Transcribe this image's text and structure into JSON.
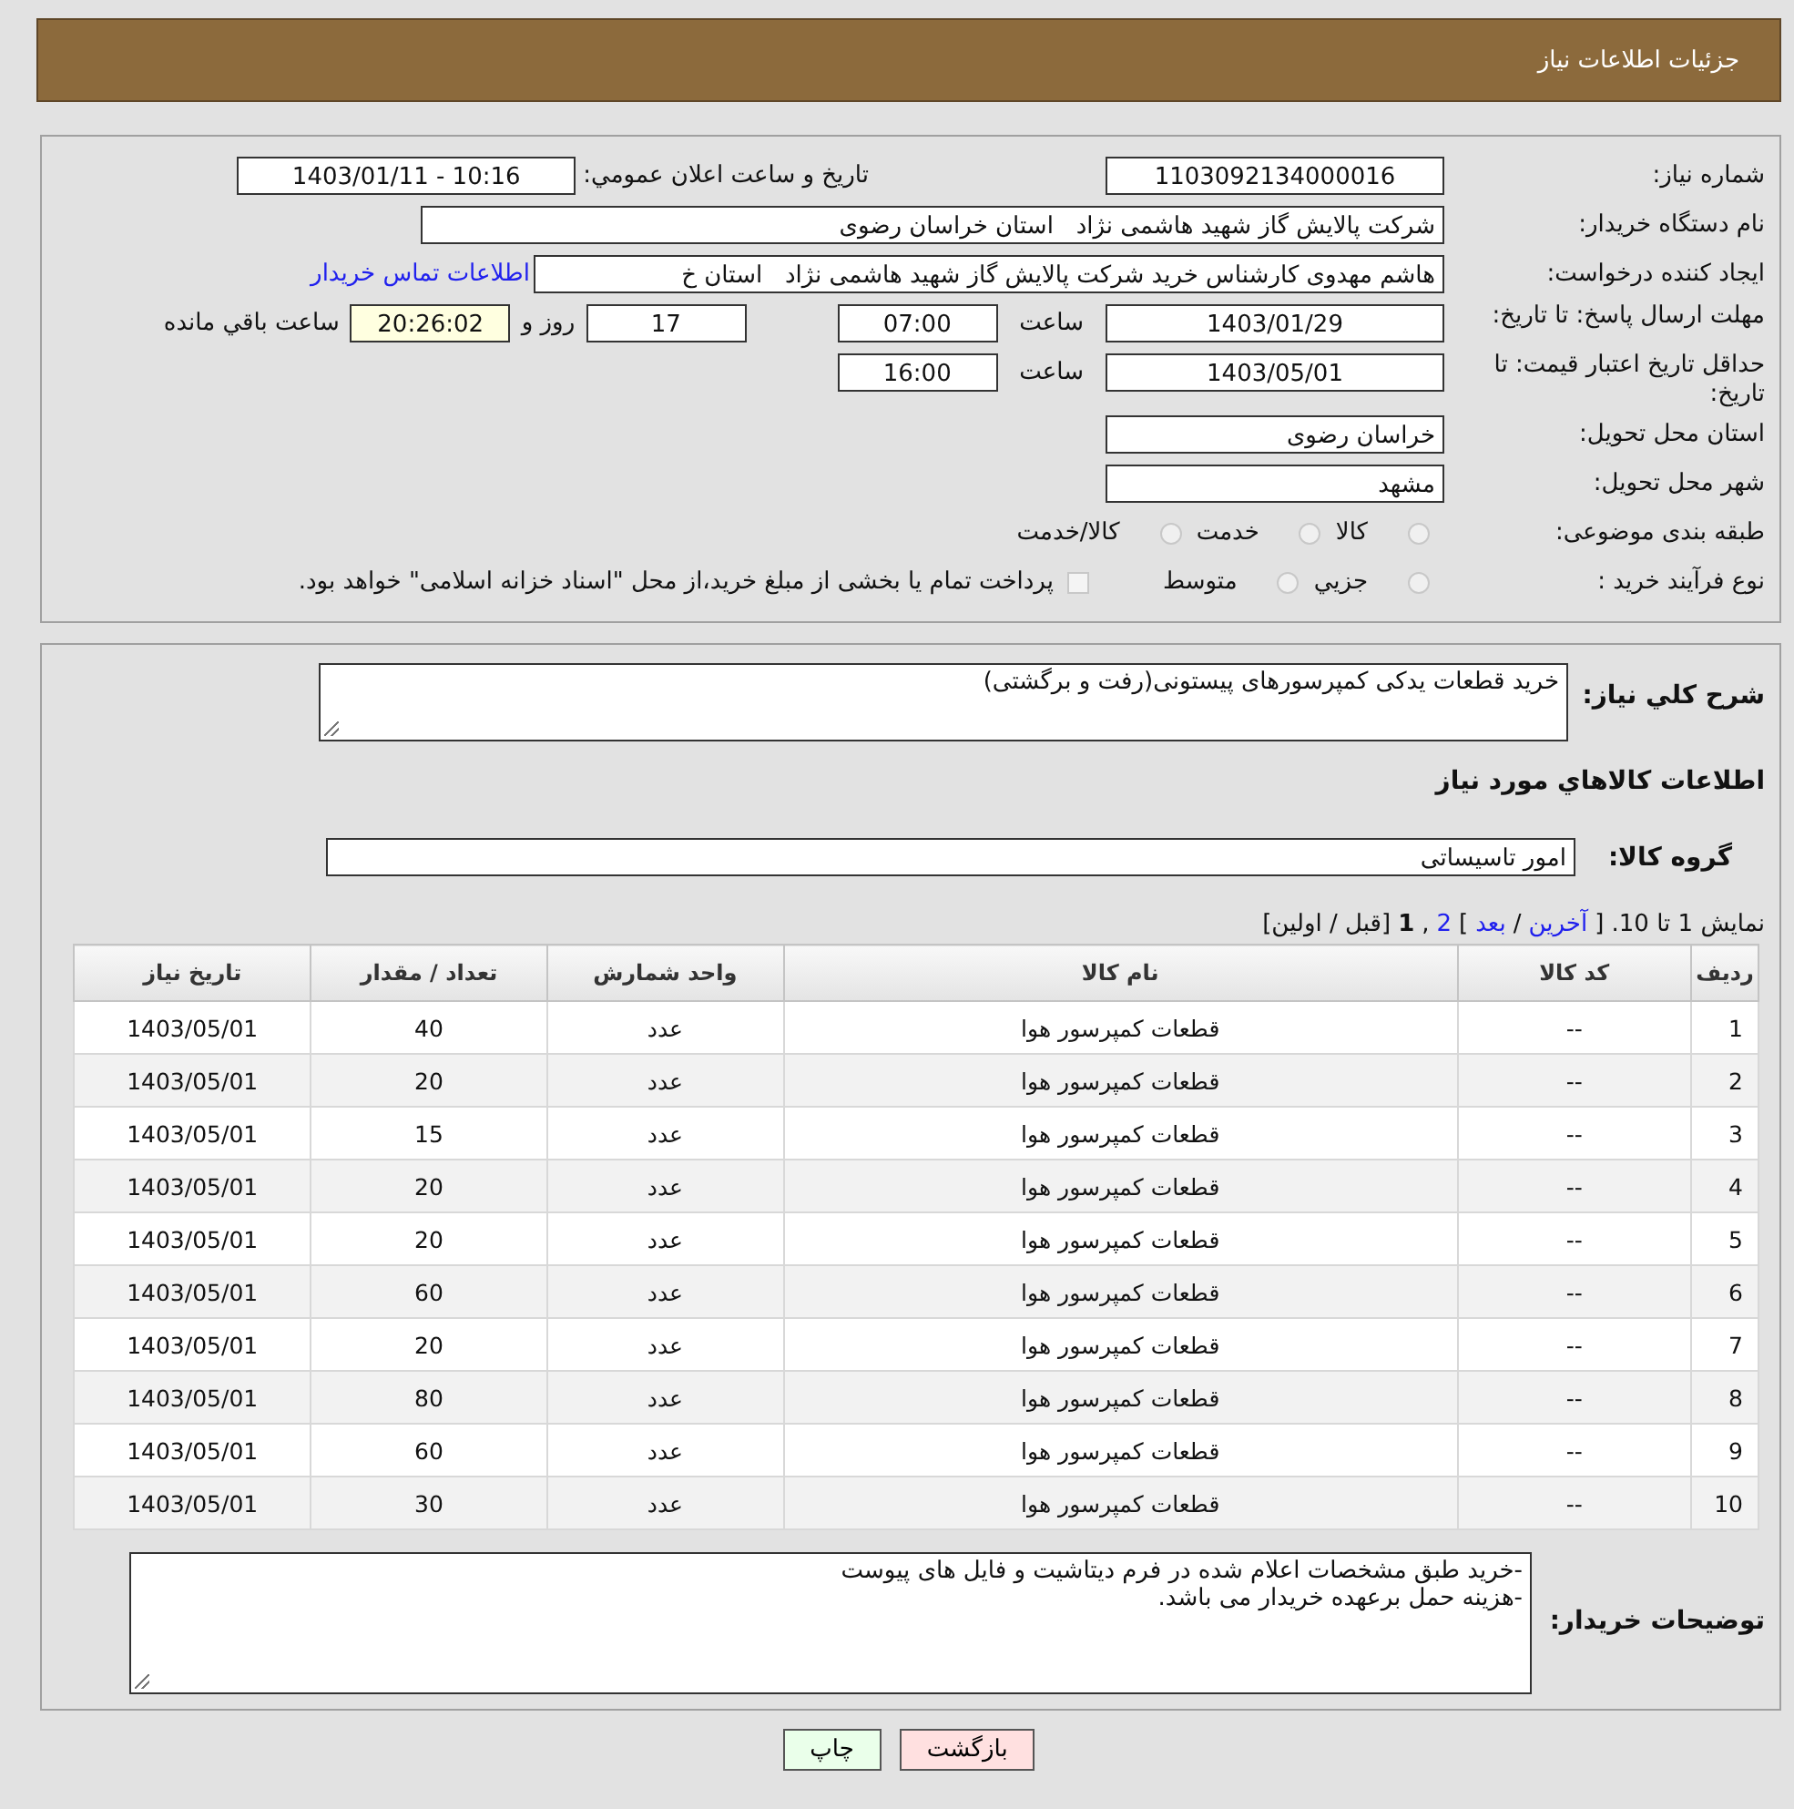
{
  "header": {
    "title": "جزئیات اطلاعات نیاز"
  },
  "details": {
    "need_number": {
      "label": "شماره نیاز:",
      "value": "1103092134000016"
    },
    "announce": {
      "label": "تاریخ و ساعت اعلان عمومي:",
      "value": "1403/01/11 - 10:16"
    },
    "buyer": {
      "label": "نام دستگاه خريدار:",
      "value": "شرکت پالایش گاز شهید هاشمی نژاد   استان خراسان رضوی"
    },
    "requester": {
      "label": "ايجاد کننده درخواست:",
      "value": "هاشم مهدوی کارشناس خرید شرکت پالایش گاز شهید هاشمی نژاد   استان خ",
      "link": "اطلاعات تماس خريدار"
    },
    "deadline": {
      "label": "مهلت ارسال پاسخ: تا تاریخ:",
      "date": "1403/01/29",
      "time_label": "ساعت",
      "time": "07:00",
      "days": "17",
      "days_label": "روز و",
      "remaining": "20:26:02",
      "remaining_label": "ساعت باقي مانده"
    },
    "validity": {
      "label": "حداقل تاريخ اعتبار قيمت: تا تاریخ:",
      "date": "1403/05/01",
      "time_label": "ساعت",
      "time": "16:00"
    },
    "province": {
      "label": "استان محل تحويل:",
      "value": "خراسان رضوی"
    },
    "city": {
      "label": "شهر محل تحويل:",
      "value": "مشهد"
    },
    "category": {
      "label": "طبقه بندی موضوعی:",
      "options": [
        {
          "label": "کالا",
          "selected": false
        },
        {
          "label": "خدمت",
          "selected": false
        },
        {
          "label": "کالا/خدمت",
          "selected": false
        }
      ]
    },
    "process": {
      "label": "نوع فرآیند خرید :",
      "options": [
        {
          "label": "جزيي",
          "selected": false
        },
        {
          "label": "متوسط",
          "selected": false
        }
      ],
      "payment": {
        "checked": false,
        "label": "پرداخت تمام یا بخشی از مبلغ خرید،از محل \"اسناد خزانه اسلامی\" خواهد بود."
      }
    }
  },
  "need": {
    "description": {
      "label": "شرح کلي نياز:",
      "value": "خرید قطعات یدکی کمپرسورهای پیستونی(رفت و برگشتی)"
    },
    "goods_title": "اطلاعات کالاهاي مورد نياز",
    "group": {
      "label": "گروه کالا:",
      "value": "امور تاسیساتی"
    },
    "pagination": [
      {
        "kind": "text",
        "text": "نمایش 1 تا 10. ["
      },
      {
        "kind": "link",
        "text": "آخرین"
      },
      {
        "kind": "text",
        "text": "/"
      },
      {
        "kind": "link",
        "text": "بعد"
      },
      {
        "kind": "text",
        "text": "]"
      },
      {
        "kind": "link",
        "text": "2"
      },
      {
        "kind": "text",
        "text": ","
      },
      {
        "kind": "current",
        "text": "1"
      },
      {
        "kind": "text",
        "text": "[قبل / اولین]"
      }
    ],
    "table": {
      "columns": [
        "ردیف",
        "کد کالا",
        "نام کالا",
        "واحد شمارش",
        "تعداد / مقدار",
        "تاریخ نیاز"
      ],
      "rows": [
        [
          "1",
          "--",
          "قطعات کمپرسور هوا",
          "عدد",
          "40",
          "1403/05/01"
        ],
        [
          "2",
          "--",
          "قطعات کمپرسور هوا",
          "عدد",
          "20",
          "1403/05/01"
        ],
        [
          "3",
          "--",
          "قطعات کمپرسور هوا",
          "عدد",
          "15",
          "1403/05/01"
        ],
        [
          "4",
          "--",
          "قطعات کمپرسور هوا",
          "عدد",
          "20",
          "1403/05/01"
        ],
        [
          "5",
          "--",
          "قطعات کمپرسور هوا",
          "عدد",
          "20",
          "1403/05/01"
        ],
        [
          "6",
          "--",
          "قطعات کمپرسور هوا",
          "عدد",
          "60",
          "1403/05/01"
        ],
        [
          "7",
          "--",
          "قطعات کمپرسور هوا",
          "عدد",
          "20",
          "1403/05/01"
        ],
        [
          "8",
          "--",
          "قطعات کمپرسور هوا",
          "عدد",
          "80",
          "1403/05/01"
        ],
        [
          "9",
          "--",
          "قطعات کمپرسور هوا",
          "عدد",
          "60",
          "1403/05/01"
        ],
        [
          "10",
          "--",
          "قطعات کمپرسور هوا",
          "عدد",
          "30",
          "1403/05/01"
        ]
      ]
    },
    "notes": {
      "label": "توضیحات خریدار:",
      "lines": [
        "-خرید طبق مشخصات اعلام شده در فرم دیتاشیت و فایل های پیوست",
        "-هزینه حمل برعهده خریدار می باشد."
      ]
    }
  },
  "buttons": [
    {
      "kind": "back",
      "label": "بازگشت"
    },
    {
      "kind": "print",
      "label": "چاپ"
    }
  ]
}
